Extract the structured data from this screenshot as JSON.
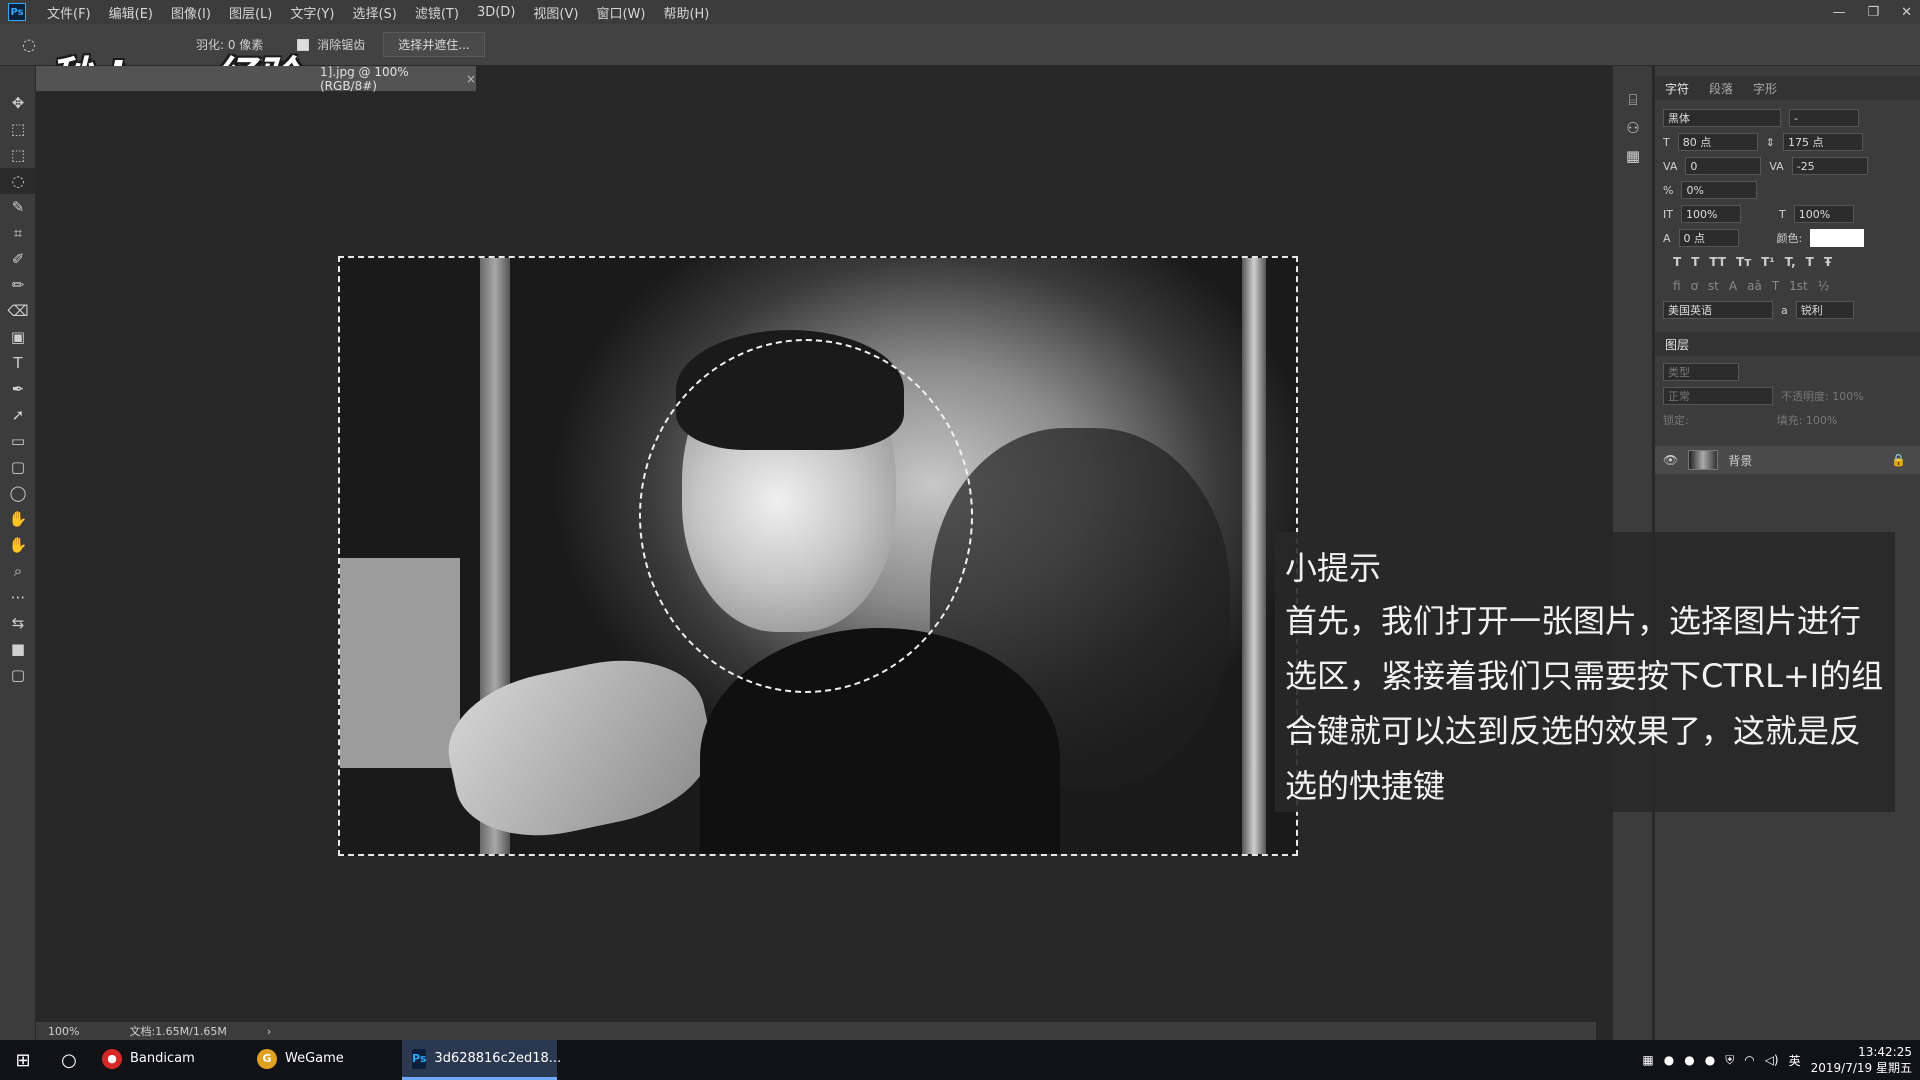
{
  "menubar": {
    "logo": "Ps",
    "items": [
      "文件(F)",
      "编辑(E)",
      "图像(I)",
      "图层(L)",
      "文字(Y)",
      "选择(S)",
      "滤镜(T)",
      "3D(D)",
      "视图(V)",
      "窗口(W)",
      "帮助(H)"
    ]
  },
  "window_controls": [
    "—",
    "❐",
    "✕"
  ],
  "options": {
    "feather": "羽化: 0 像素",
    "antialias": "消除锯齿",
    "select_mask": "选择并遮住..."
  },
  "watermark": "秒dong经验",
  "document_tab": {
    "label": "1].jpg @ 100%(RGB/8#)",
    "close": "×"
  },
  "tools": [
    "✥",
    "⬚",
    "⬚",
    "◌",
    "✎",
    "⌗",
    "✐",
    "✏",
    "⌫",
    "▣",
    "T",
    "✒",
    "➚",
    "▭",
    "▢",
    "◯",
    "✋",
    "✋",
    "⌕",
    "⋯",
    "⇆",
    "■",
    "▢"
  ],
  "status": {
    "zoom": "100%",
    "doc": "文档:1.65M/1.65M",
    "arrow": "›"
  },
  "character_panel": {
    "tabs": [
      "字符",
      "段落",
      "字形"
    ],
    "font": "黑体",
    "style": "-",
    "size": "80 点",
    "leading": "175 点",
    "kerning": "0",
    "tracking": "-25",
    "scale_pct": "0%",
    "vscale": "100%",
    "hscale": "100%",
    "baseline": "0 点",
    "color_label": "颜色:",
    "language": "美国英语",
    "aa": "锐利",
    "glyph_buttons": [
      "T",
      "T",
      "TT",
      "Tт",
      "T¹",
      "T,",
      "T",
      "Ŧ"
    ],
    "glyph_buttons2": [
      "fi",
      "ơ",
      "st",
      "A",
      "aā",
      "T",
      "1st",
      "½"
    ]
  },
  "layers_panel": {
    "title": "图层",
    "filter": "类型",
    "blend": "正常",
    "opacity": "不透明度: 100%",
    "lock": "锁定:",
    "fill": "填充: 100%",
    "layer_name": "背景"
  },
  "tip": {
    "title": "小提示",
    "body": "首先，我们打开一张图片，选择图片进行选区，紧接着我们只需要按下CTRL+I的组合键就可以达到反选的效果了，这就是反选的快捷键"
  },
  "taskbar": {
    "start": "⊞",
    "search": "○",
    "apps": [
      {
        "label": "Bandicam",
        "color": "#d62828",
        "glyph": "●"
      },
      {
        "label": "WeGame",
        "color": "#e0a020",
        "glyph": "G"
      },
      {
        "label": "3d628816c2ed18...",
        "color": "#0a1f3a",
        "glyph": "Ps"
      }
    ],
    "lang": "英",
    "time": "13:42:25",
    "date": "2019/7/19 星期五"
  }
}
